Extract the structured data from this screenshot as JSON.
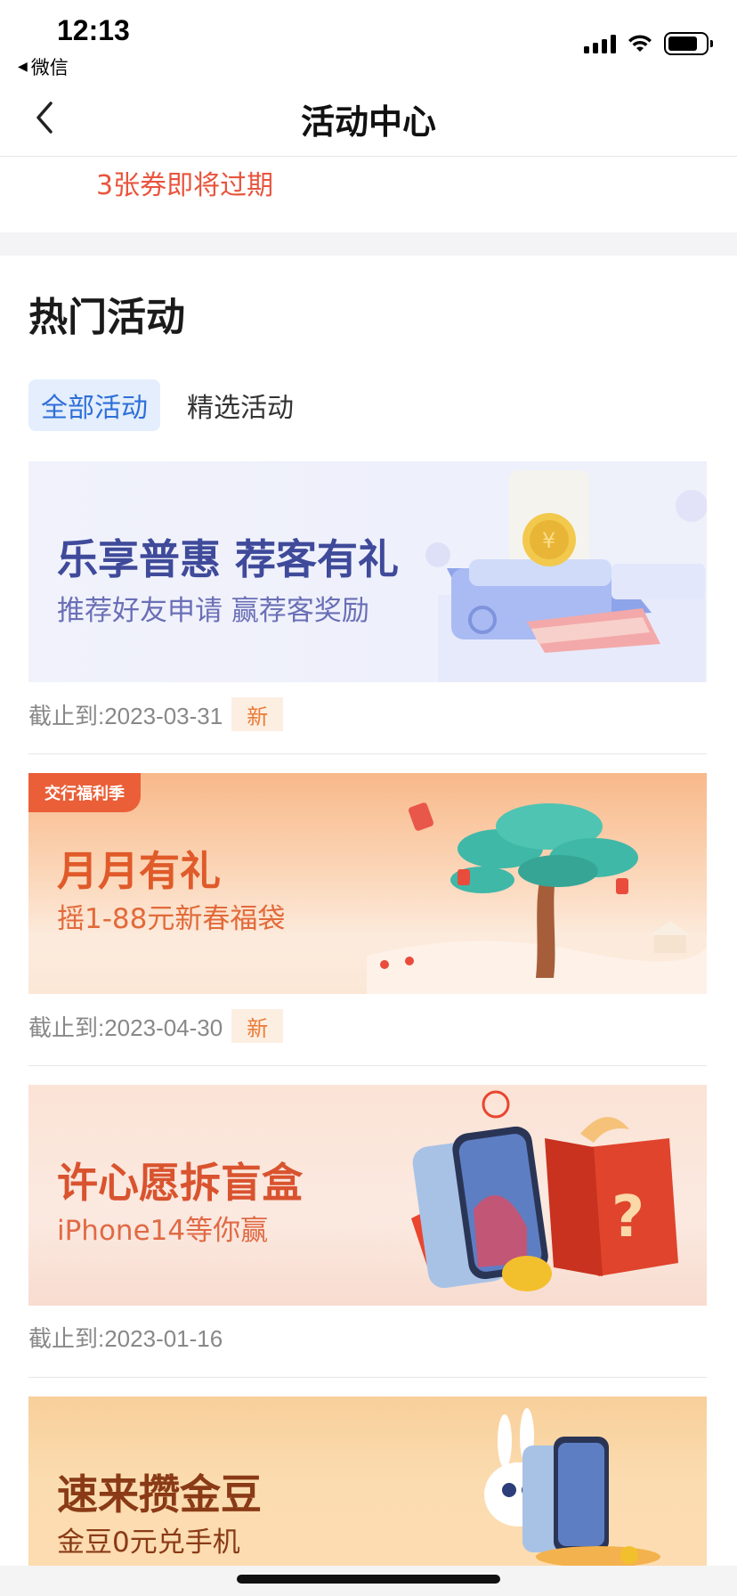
{
  "status_bar": {
    "time": "12:13",
    "back_app": "微信"
  },
  "nav": {
    "title": "活动中心",
    "back_icon": "chevron-left-icon"
  },
  "notice": {
    "expiring_text": "3张券即将过期",
    "color": "#e8553e"
  },
  "section": {
    "title": "热门活动"
  },
  "tabs": [
    {
      "label": "全部活动",
      "active": true
    },
    {
      "label": "精选活动",
      "active": false
    }
  ],
  "activities": [
    {
      "title": "乐享普惠 荐客有礼",
      "subtitle": "推荐好友申请 赢荐客奖励",
      "deadline": "截止到:2023-03-31",
      "badge": "新"
    },
    {
      "tag": "交行福利季",
      "title": "月月有礼",
      "subtitle": "摇1-88元新春福袋",
      "deadline": "截止到:2023-04-30",
      "badge": "新"
    },
    {
      "title": "许心愿拆盲盒",
      "subtitle": "iPhone14等你赢",
      "deadline": "截止到:2023-01-16",
      "badge": ""
    },
    {
      "title": "速来攒金豆",
      "subtitle": "金豆0元兑手机"
    }
  ],
  "colors": {
    "accent": "#2e6fd8",
    "badge_text": "#ea7b36",
    "badge_bg": "#fdeee2"
  }
}
